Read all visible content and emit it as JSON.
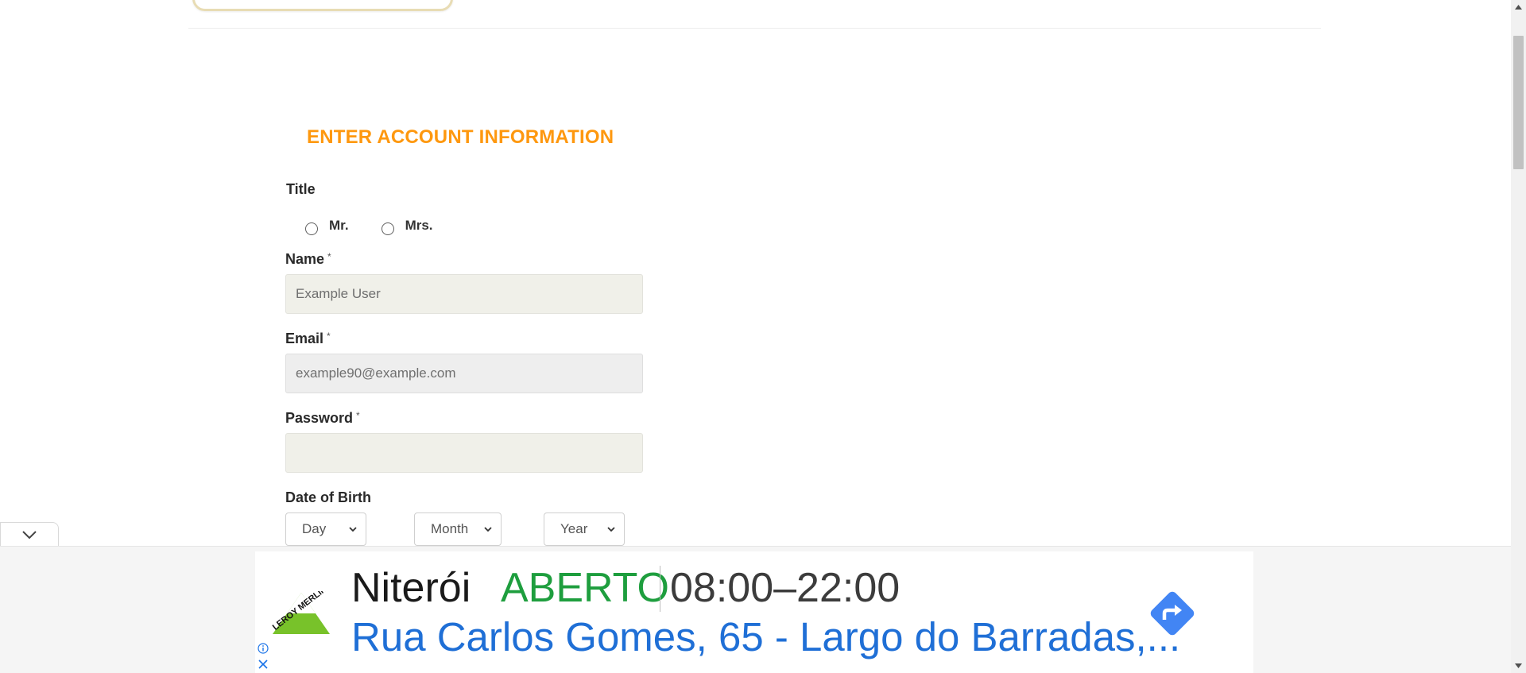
{
  "form": {
    "heading": "ENTER ACCOUNT INFORMATION",
    "title_label": "Title",
    "title_options": [
      "Mr.",
      "Mrs."
    ],
    "name_label": "Name",
    "name_value": "Example User",
    "email_label": "Email",
    "email_value": "example90@example.com",
    "password_label": "Password",
    "password_value": "",
    "required_marker": "*",
    "dob_label": "Date of Birth",
    "dob_day": "Day",
    "dob_month": "Month",
    "dob_year": "Year"
  },
  "ad": {
    "city": "Niterói",
    "status": "ABERTO",
    "hours": "08:00–22:00",
    "address": "Rua Carlos Gomes, 65 - Largo do Barradas,...",
    "logo_text": "LEROY MERLIN",
    "colors": {
      "open": "#1e9e3e",
      "address": "#1f6fd6",
      "directions": "#4285f4",
      "logo_green": "#78c22a"
    }
  },
  "colors": {
    "accent": "#fe980f",
    "field_bg": "#f0f0e9"
  }
}
